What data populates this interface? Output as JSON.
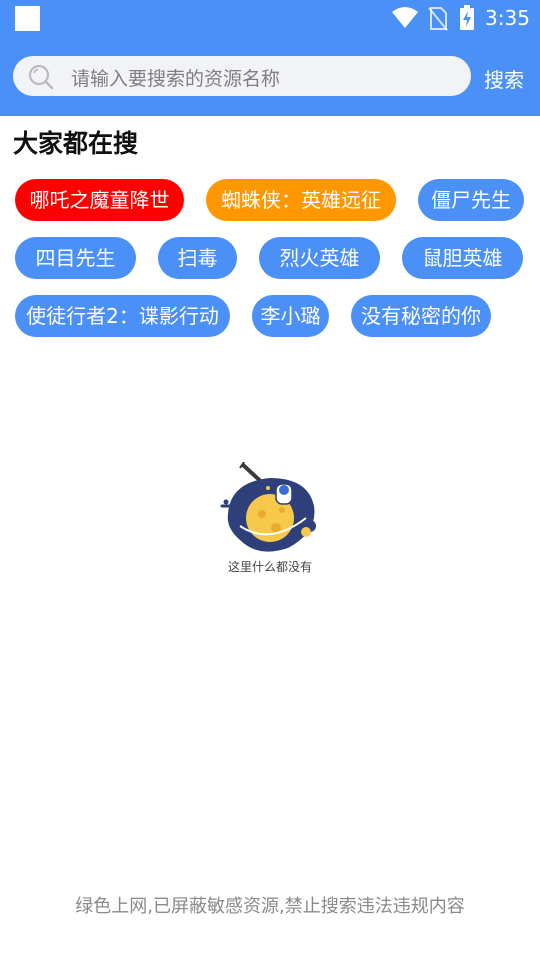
{
  "status_bar": {
    "time": "3:35",
    "icons": [
      "square-icon",
      "wifi-icon",
      "no-sim-icon",
      "battery-charging-icon"
    ]
  },
  "header": {
    "search_placeholder": "请输入要搜索的资源名称",
    "search_button": "搜索",
    "background_color": "#4a90f7"
  },
  "section": {
    "title": "大家都在搜"
  },
  "hot_tags": [
    {
      "label": "哪吒之魔童降世",
      "color": "#ff0000"
    },
    {
      "label": "蜘蛛侠：英雄远征",
      "color": "#ff9800"
    },
    {
      "label": "僵尸先生",
      "color": "#4a90f7"
    },
    {
      "label": "四目先生",
      "color": "#4a90f7"
    },
    {
      "label": "扫毒",
      "color": "#4a90f7"
    },
    {
      "label": "烈火英雄",
      "color": "#4a90f7"
    },
    {
      "label": "鼠胆英雄",
      "color": "#4a90f7"
    },
    {
      "label": "使徒行者2：谍影行动",
      "color": "#4a90f7"
    },
    {
      "label": "李小璐",
      "color": "#4a90f7"
    },
    {
      "label": "没有秘密的你",
      "color": "#4a90f7"
    }
  ],
  "empty_state": {
    "text": "这里什么都没有",
    "illustration": "astronaut-planet-illustration"
  },
  "footer": {
    "notice": "绿色上网,已屏蔽敏感资源,禁止搜索违法违规内容"
  }
}
